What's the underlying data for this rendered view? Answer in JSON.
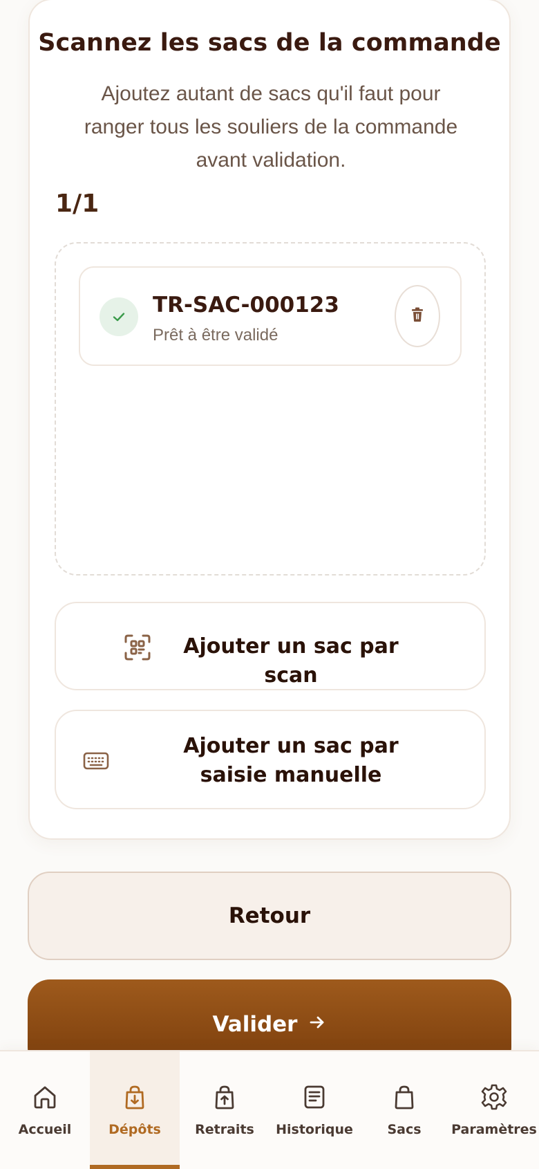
{
  "card": {
    "title": "Scannez les sacs de la commande",
    "subtitle": "Ajoutez autant de sacs qu'il faut pour ranger tous les souliers de la commande avant validation.",
    "counter": "1/1",
    "bags": [
      {
        "code": "TR-SAC-000123",
        "status": "Prêt à être validé"
      }
    ],
    "add_scan_label": "Ajouter un sac par scan",
    "add_manual_label": "Ajouter un sac par saisie manuelle"
  },
  "actions": {
    "back_label": "Retour",
    "validate_label": "Valider"
  },
  "nav": {
    "items": [
      {
        "label": "Accueil",
        "icon": "home-icon",
        "active": false
      },
      {
        "label": "Dépôts",
        "icon": "deposit-bag-icon",
        "active": true
      },
      {
        "label": "Retraits",
        "icon": "withdraw-bag-icon",
        "active": false
      },
      {
        "label": "Historique",
        "icon": "history-document-icon",
        "active": false
      },
      {
        "label": "Sacs",
        "icon": "bag-icon",
        "active": false
      },
      {
        "label": "Paramètres",
        "icon": "gear-icon",
        "active": false
      }
    ]
  },
  "colors": {
    "accent": "#b06a22",
    "primary_button": "#8a4a14",
    "text_dark": "#3a1a10",
    "success": "#3a9a4a",
    "success_bg": "#e6f2e8"
  }
}
